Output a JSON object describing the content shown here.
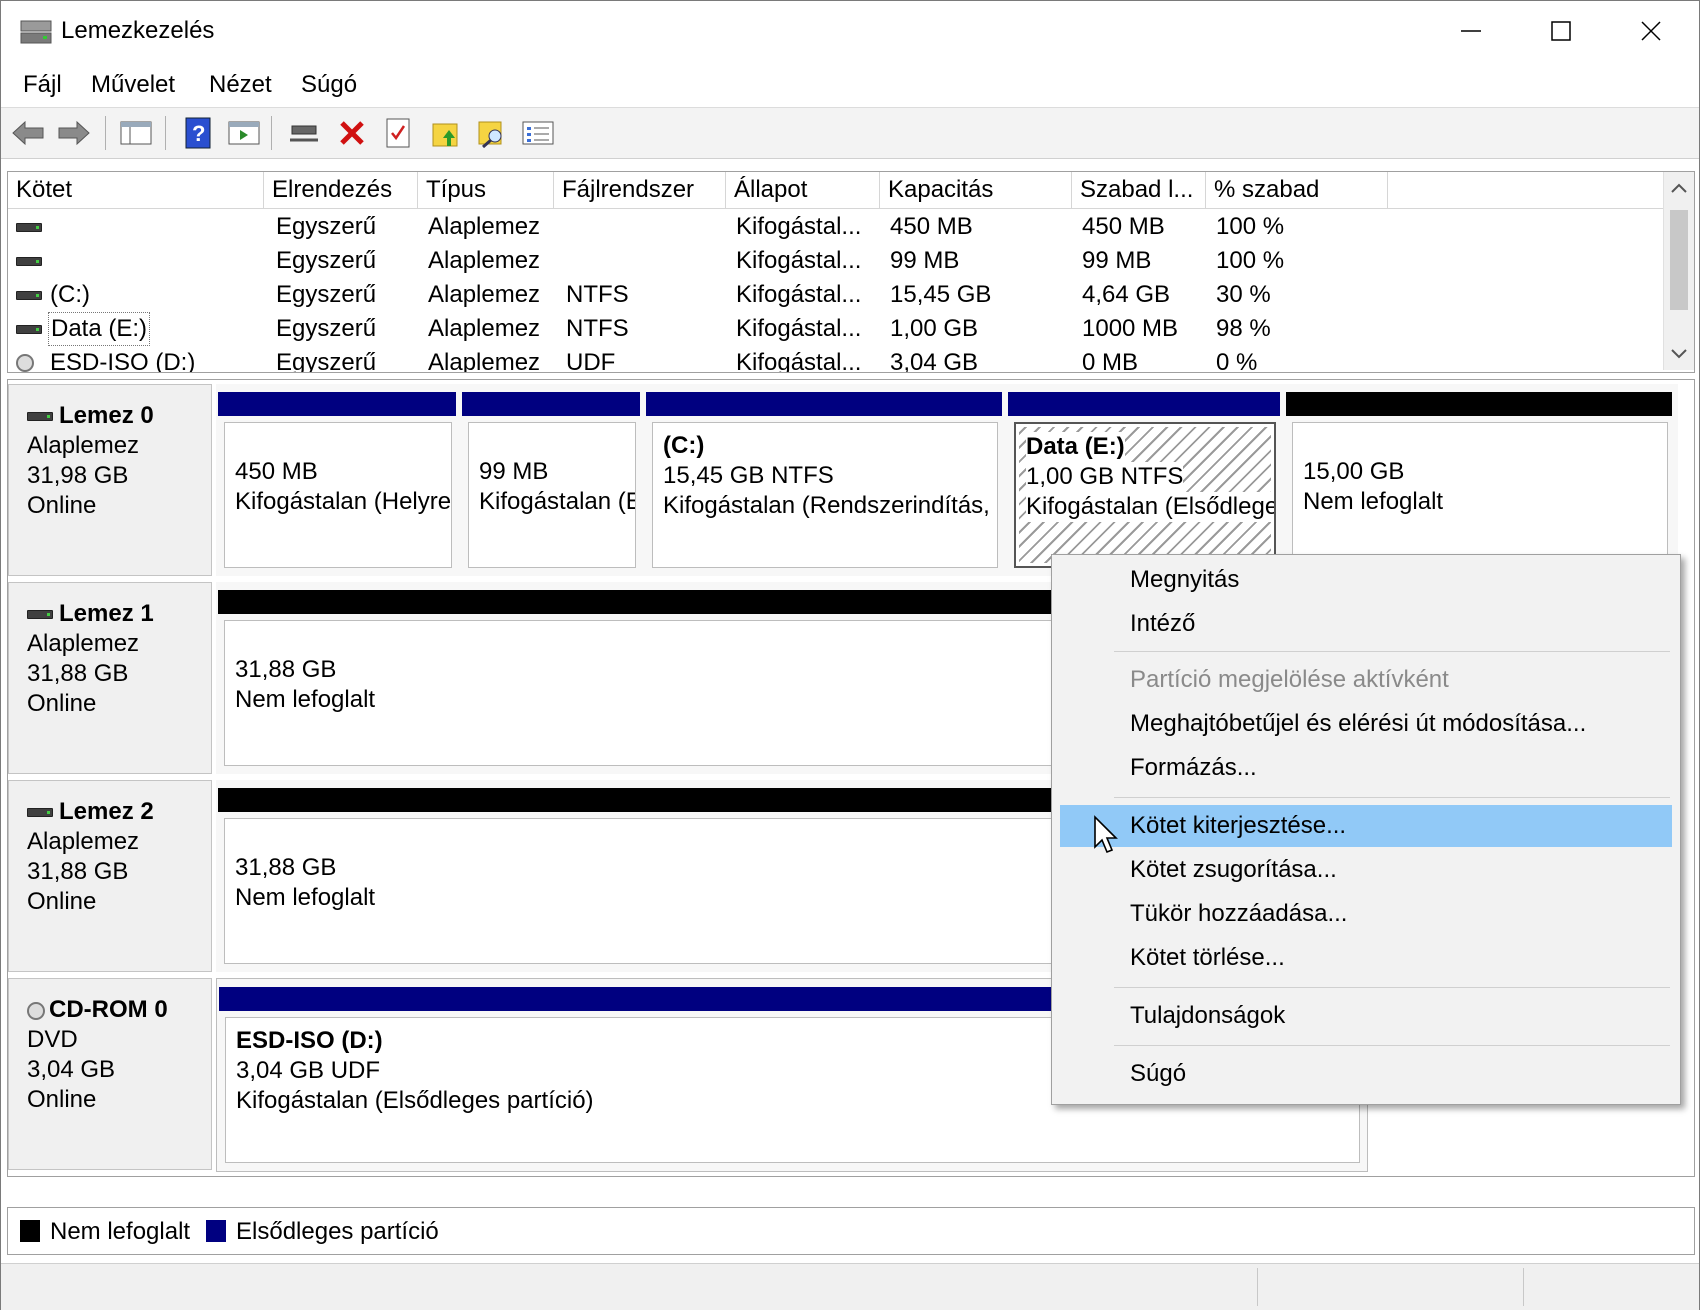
{
  "window": {
    "title": "Lemezkezelés"
  },
  "menu": [
    "Fájl",
    "Művelet",
    "Nézet",
    "Súgó"
  ],
  "toolbar_icons": [
    "back-arrow-icon",
    "forward-arrow-icon",
    "console-tree-icon",
    "help-icon",
    "action-pane-icon",
    "connect-icon",
    "delete-icon",
    "properties-icon",
    "up-folder-icon",
    "search-folder-icon",
    "list-view-icon"
  ],
  "volume_list": {
    "columns": [
      "Kötet",
      "Elrendezés",
      "Típus",
      "Fájlrendszer",
      "Állapot",
      "Kapacitás",
      "Szabad l...",
      "% szabad"
    ],
    "rows": [
      {
        "volume": "",
        "layout": "Egyszerű",
        "type": "Alaplemez",
        "fs": "",
        "status": "Kifogástal...",
        "capacity": "450 MB",
        "free": "450 MB",
        "pct": "100 %"
      },
      {
        "volume": "",
        "layout": "Egyszerű",
        "type": "Alaplemez",
        "fs": "",
        "status": "Kifogástal...",
        "capacity": "99 MB",
        "free": "99 MB",
        "pct": "100 %"
      },
      {
        "volume": "(C:)",
        "layout": "Egyszerű",
        "type": "Alaplemez",
        "fs": "NTFS",
        "status": "Kifogástal...",
        "capacity": "15,45 GB",
        "free": "4,64 GB",
        "pct": "30 %"
      },
      {
        "volume": "Data (E:)",
        "layout": "Egyszerű",
        "type": "Alaplemez",
        "fs": "NTFS",
        "status": "Kifogástal...",
        "capacity": "1,00 GB",
        "free": "1000 MB",
        "pct": "98 %"
      },
      {
        "volume": "ESD-ISO (D:)",
        "layout": "Egyszerű",
        "type": "Alaplemez",
        "fs": "UDF",
        "status": "Kifogástal...",
        "capacity": "3,04 GB",
        "free": "0 MB",
        "pct": "0 %"
      }
    ]
  },
  "disks": [
    {
      "name": "Lemez 0",
      "type": "Alaplemez",
      "size": "31,98 GB",
      "state": "Online",
      "partitions": [
        {
          "title": "",
          "l1": "450 MB",
          "l2": "Kifogástalan (Helyre"
        },
        {
          "title": "",
          "l1": "99 MB",
          "l2": "Kifogástalan (E"
        },
        {
          "title": "(C:)",
          "l1": "15,45 GB NTFS",
          "l2": "Kifogástalan (Rendszerindítás, Lap"
        },
        {
          "title": "Data  (E:)",
          "l1": "1,00 GB NTFS",
          "l2": "Kifogástalan (Elsődlege"
        },
        {
          "title": "",
          "l1": "15,00 GB",
          "l2": "Nem lefoglalt"
        }
      ]
    },
    {
      "name": "Lemez 1",
      "type": "Alaplemez",
      "size": "31,88 GB",
      "state": "Online",
      "partitions": [
        {
          "title": "",
          "l1": "31,88 GB",
          "l2": "Nem lefoglalt"
        }
      ]
    },
    {
      "name": "Lemez 2",
      "type": "Alaplemez",
      "size": "31,88 GB",
      "state": "Online",
      "partitions": [
        {
          "title": "",
          "l1": "31,88 GB",
          "l2": "Nem lefoglalt"
        }
      ]
    },
    {
      "name": "CD-ROM 0",
      "type": "DVD",
      "size": "3,04 GB",
      "state": "Online",
      "partitions": [
        {
          "title": "ESD-ISO  (D:)",
          "l1": "3,04 GB UDF",
          "l2": "Kifogástalan (Elsődleges partíció)"
        }
      ]
    }
  ],
  "legend": [
    {
      "label": "Nem lefoglalt",
      "color": "#000000"
    },
    {
      "label": "Elsődleges partíció",
      "color": "#000080"
    }
  ],
  "context_menu": {
    "items": [
      {
        "label": "Megnyitás",
        "state": "normal"
      },
      {
        "label": "Intéző",
        "state": "normal"
      },
      {
        "label": "Partíció megjelölése aktívként",
        "state": "disabled"
      },
      {
        "label": "Meghajtóbetűjel és elérési út módosítása...",
        "state": "normal"
      },
      {
        "label": "Formázás...",
        "state": "normal"
      },
      {
        "label": "Kötet kiterjesztése...",
        "state": "highlighted"
      },
      {
        "label": "Kötet zsugorítása...",
        "state": "normal"
      },
      {
        "label": "Tükör hozzáadása...",
        "state": "normal"
      },
      {
        "label": "Kötet törlése...",
        "state": "normal"
      },
      {
        "label": "Tulajdonságok",
        "state": "normal"
      },
      {
        "label": "Súgó",
        "state": "normal"
      }
    ]
  },
  "colors": {
    "primary_partition": "#000080",
    "unallocated": "#000000",
    "highlight": "#91c9f7"
  }
}
